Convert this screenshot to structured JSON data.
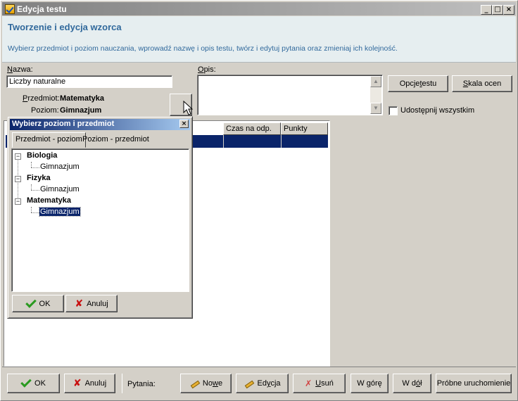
{
  "window": {
    "title": "Edycja testu",
    "controls": {
      "minimize": "_",
      "maximize": "□",
      "close": "×"
    }
  },
  "header": {
    "title": "Tworzenie i edycja wzorca",
    "subtitle": "Wybierz przedmiot i poziom nauczania, wprowadź nazwę i opis testu, twórz i edytuj pytania oraz zmieniaj ich kolejność."
  },
  "form": {
    "name_label_first": "N",
    "name_label_rest": "azwa:",
    "name_value": "Liczby naturalne",
    "desc_label_first": "O",
    "desc_label_rest": "pis:",
    "desc_value": "",
    "subject_label_first": "P",
    "subject_label_rest": "rzedmiot:",
    "subject_value": "Matematyka",
    "level_label": "Poziom:",
    "level_value": "Gimnazjum",
    "test_options_button_pre": "Opcje ",
    "test_options_button_u": "t",
    "test_options_button_post": "estu",
    "grade_scale_button_u": "S",
    "grade_scale_button_post": "kala ocen",
    "share_checkbox_label": "Udostępnij wszystkim",
    "share_checked": false
  },
  "questions_table": {
    "columns": [
      "Czas na odp.",
      "Punkty"
    ]
  },
  "popup": {
    "title": "Wybierz poziom i przedmiot",
    "close": "×",
    "tabs": [
      "Przedmiot - poziom",
      "Poziom - przedmiot"
    ],
    "active_tab": 0,
    "tree": [
      {
        "label": "Biologia",
        "children": [
          "Gimnazjum"
        ]
      },
      {
        "label": "Fizyka",
        "children": [
          "Gimnazjum"
        ]
      },
      {
        "label": "Matematyka",
        "children": [
          "Gimnazjum"
        ]
      }
    ],
    "expander_symbol": "−",
    "ok_button": "OK",
    "cancel_button": "Anuluj"
  },
  "bottom_bar": {
    "ok_button": "OK",
    "cancel_button": "Anuluj",
    "questions_label": "Pytania:",
    "new_button_pre": "No",
    "new_button_u": "w",
    "new_button_post": "e",
    "edit_button_pre": "Ed",
    "edit_button_u": "y",
    "edit_button_post": "cja",
    "delete_button_u": "U",
    "delete_button_post": "suń",
    "up_button_pre": "W ",
    "up_button_u": "g",
    "up_button_post": "órę",
    "down_button_pre": "W d",
    "down_button_u": "ó",
    "down_button_post": "ł",
    "trial_run_button": "Próbne uruchomienie"
  },
  "icons": {
    "ok": "checkmark-icon",
    "cancel": "x-icon",
    "new": "pencil-icon",
    "edit": "pencil-icon",
    "delete": "eraser-icon"
  }
}
